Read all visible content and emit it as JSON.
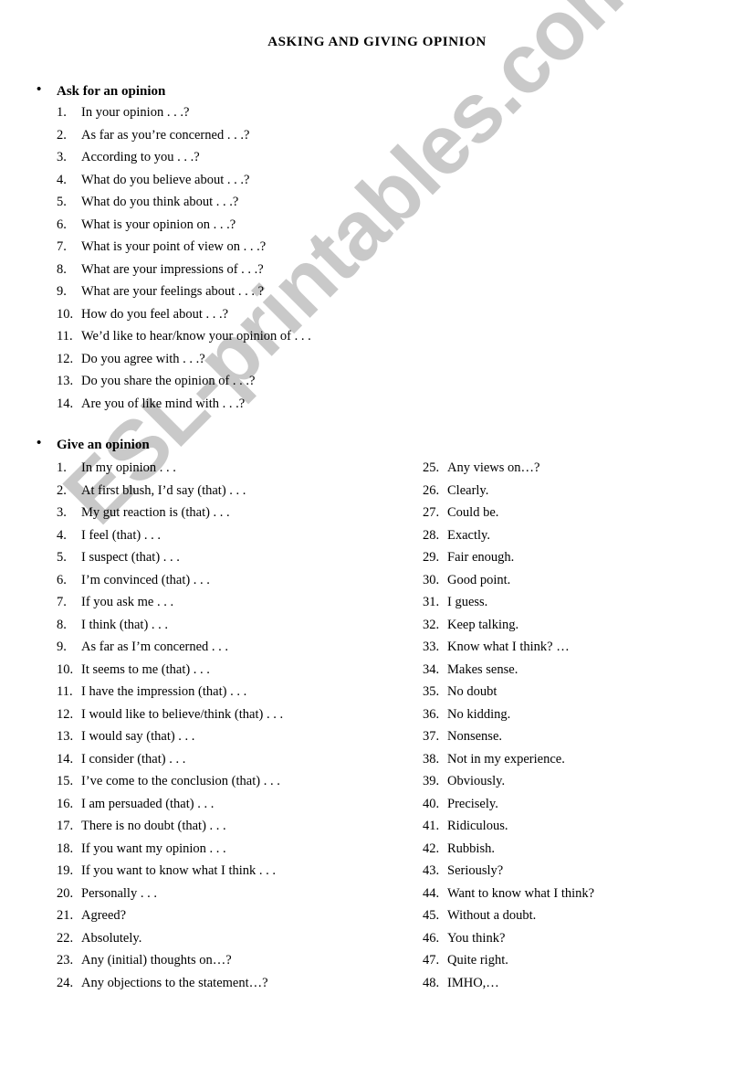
{
  "document": {
    "title": "ASKING AND GIVING OPINION",
    "watermark": "ESL-printables.com",
    "bullet_glyph": "•"
  },
  "sections": [
    {
      "heading": "Ask for an opinion",
      "items": [
        "In your opinion . . .?",
        "As far as you’re concerned . . .?",
        "According to you . . .?",
        "What do you believe about . . .?",
        "What do you think about . . .?",
        "What is your opinion on . . .?",
        "What is your point of view on . . .?",
        "What are your impressions of . . .?",
        "What are your feelings about . . . ?",
        "How do you feel about . . .?",
        "We’d like to hear/know your opinion of . . .",
        "Do you agree with . . .?",
        "Do you share the opinion of . . .?",
        "Are you of like mind with . . .?"
      ]
    },
    {
      "heading": "Give an opinion",
      "items_left": [
        "In my opinion . . .",
        "At first blush, I’d say (that) . . .",
        "My gut reaction is (that) . . .",
        "I feel (that) . . .",
        "I suspect (that) . . .",
        "I’m convinced (that) . . .",
        "If you ask me . . .",
        "I think (that) . . .",
        "As far as I’m concerned . . .",
        "It seems to me (that) . . .",
        "I have the impression (that) . . .",
        "I would like to believe/think (that) . . .",
        " I would say (that) . . .",
        "I consider (that) . . .",
        "I’ve come to the conclusion (that) . . .",
        "I am persuaded (that) . . .",
        "There is no doubt (that) . . .",
        "If you want my opinion . . .",
        "If you want to know what I think . . .",
        "Personally . . .",
        "Agreed?",
        "Absolutely.",
        "Any (initial) thoughts on…?",
        "Any objections to the statement…?"
      ],
      "items_right": [
        "Any views on…?",
        "Clearly.",
        "Could be.",
        "Exactly.",
        "Fair enough.",
        "Good point.",
        "I guess.",
        "Keep talking.",
        "Know what I think? …",
        "Makes sense.",
        "No doubt",
        "No kidding.",
        "Nonsense.",
        "Not in my experience.",
        "Obviously.",
        "Precisely.",
        "Ridiculous.",
        "Rubbish.",
        "Seriously?",
        "Want to know what I think?",
        "Without a doubt.",
        "You think?",
        "Quite right.",
        "IMHO,…"
      ],
      "numbers_left": [
        "1.",
        "2.",
        "3.",
        "4.",
        "5.",
        "6.",
        "7.",
        "8.",
        "9.",
        "10.",
        "11.",
        "12.",
        "13.",
        "14.",
        "15.",
        "16.",
        "17.",
        "18.",
        "19.",
        "20.",
        "21.",
        "22.",
        "23.",
        "24."
      ],
      "numbers_right": [
        "25.",
        "26.",
        "27.",
        "28.",
        "29.",
        "30.",
        "31.",
        "32.",
        "33.",
        "34.",
        "35.",
        "36.",
        "37.",
        "38.",
        "39.",
        "40.",
        "41.",
        "42.",
        "43.",
        "44.",
        "45.",
        "46.",
        "47.",
        "48."
      ]
    }
  ],
  "numbers_ask": [
    "1.",
    "2.",
    "3.",
    "4.",
    "5.",
    "6.",
    "7.",
    "8.",
    "9.",
    "10.",
    "11.",
    "12.",
    "13.",
    "14."
  ]
}
